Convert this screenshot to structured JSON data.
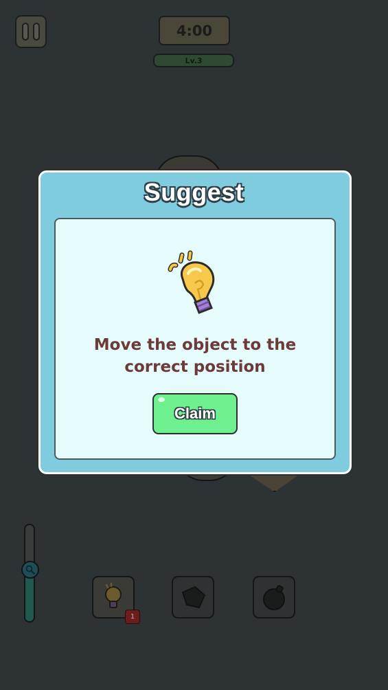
{
  "hud": {
    "timer": "4:00",
    "level": "Lv.3"
  },
  "zoom": {
    "level": 0.45
  },
  "tools": [
    {
      "name": "hint-bulb",
      "count": "1",
      "enabled": true
    },
    {
      "name": "shape-locked",
      "enabled": false
    },
    {
      "name": "bomb-locked",
      "enabled": false
    }
  ],
  "modal": {
    "title": "Suggest",
    "message_line1": "Move the object to the",
    "message_line2": "correct position",
    "claim_label": "Claim"
  },
  "colors": {
    "modal_frame": "#7fccdf",
    "modal_inner": "#e6fcfc",
    "claim_button": "#6ef08f",
    "message_text": "#6c3a37",
    "backdrop": "#2d3235"
  },
  "icons": {
    "pause": "pause-icon",
    "bulb": "lightbulb-icon",
    "zoom": "magnifier-icon"
  }
}
